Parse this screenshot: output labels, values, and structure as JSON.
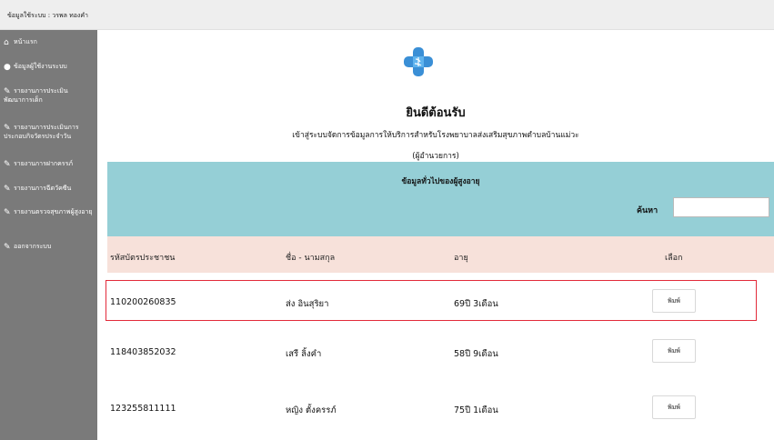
{
  "topbar": {
    "user_text": "ข้อมูลใช้ระบบ : วรพล ทองคำ"
  },
  "sidebar": {
    "items": [
      {
        "label": "หน้าแรก",
        "icon": "home-icon"
      },
      {
        "label": "ข้อมูลผู้ใช้งานระบบ",
        "icon": "user-icon"
      },
      {
        "label": "รายงานการประเมินพัฒนาการเด็ก",
        "icon": "edit-icon"
      },
      {
        "label": "รายงานการประเมินการประกอบกิจวัตรประจำวัน",
        "icon": "edit-icon"
      },
      {
        "label": "รายงานการฝากครรภ์",
        "icon": "edit-icon"
      },
      {
        "label": "รายงานการฉีดวัคซีน",
        "icon": "edit-icon"
      },
      {
        "label": "รายงานตรวจสุขภาพผู้สูงอายุ",
        "icon": "edit-icon"
      },
      {
        "label": "ออกจากระบบ",
        "icon": "logout-icon"
      }
    ]
  },
  "main": {
    "title": "ยินดีต้อนรับ",
    "subtitle": "เข้าสู่ระบบจัดการข้อมูลการให้บริการสำหรับโรงพยาบาลส่งเสริมสุขภาพตำบลบ้านแม่วะ",
    "role": "(ผู้อำนวยการ)",
    "section_title": "ข้อมูลทั่วไปของผู้สูงอายุ",
    "search_label": "ค้นหา",
    "search_value": "",
    "columns": [
      "รหัสบัตรประชาชน",
      "ชื่อ - นามสกุล",
      "อายุ",
      "เลือก"
    ],
    "rows": [
      {
        "id": "110200260835",
        "name": "ส่ง อินสุริยา",
        "age": "69ปี 3เดือน",
        "action": "พิมพ์"
      },
      {
        "id": "118403852032",
        "name": "เสรี ลิ้งคำ",
        "age": "58ปี 9เดือน",
        "action": "พิมพ์"
      },
      {
        "id": "123255811111",
        "name": "หญิง ตั้งครรภ์",
        "age": "75ปี 1เดือน",
        "action": "พิมพ์"
      }
    ]
  },
  "colors": {
    "sidebar_bg": "#7a7a7a",
    "section_bg": "#95cfd6",
    "header_bg": "#f7e1da",
    "highlight": "#e22a3a",
    "logo_blue": "#3a8fd6"
  }
}
